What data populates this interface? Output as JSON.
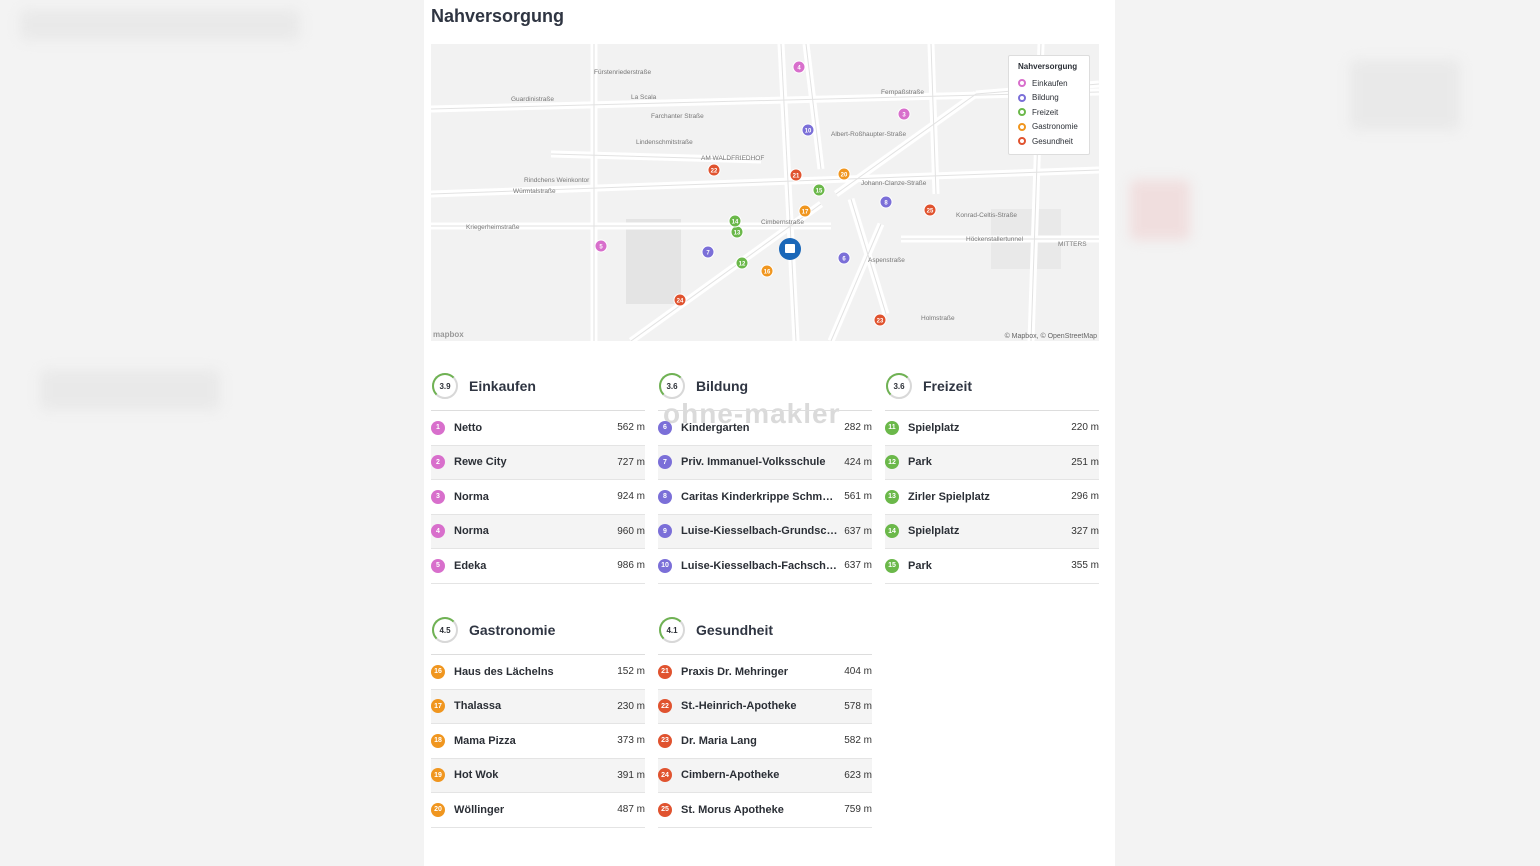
{
  "title": "Nahversorgung",
  "map": {
    "legend": {
      "title": "Nahversorgung",
      "items": [
        {
          "label": "Einkaufen",
          "color": "#d86fcc"
        },
        {
          "label": "Bildung",
          "color": "#7b6fd8"
        },
        {
          "label": "Freizeit",
          "color": "#6bb84a"
        },
        {
          "label": "Gastronomie",
          "color": "#f0961f"
        },
        {
          "label": "Gesundheit",
          "color": "#e0532f"
        }
      ]
    },
    "attribution": "© Mapbox, © OpenStreetMap",
    "logo": "mapbox",
    "labels": [
      "La Scala",
      "Guardinistraße",
      "Farchanter Straße",
      "Rindchens Weinkontor",
      "Würmtalstraße",
      "AM WALDFRIEDHOF",
      "Johann-Clanze-Straße",
      "Albert-Roßhaupter-Straße",
      "Konrad-Celtis-Straße",
      "Höckenstallertunnel",
      "MITTERS",
      "Cimbernstraße",
      "Aspenstraße",
      "Holmstraße",
      "Fernpaßstraße",
      "Lindenschmitstraße",
      "Kriegerheimstraße",
      "Fürstenriederstraße"
    ]
  },
  "watermark": "ohne-makler",
  "sections": [
    {
      "title": "Einkaufen",
      "score": "3.9",
      "color": "#d86fcc",
      "items": [
        {
          "n": "1",
          "name": "Netto",
          "dist": "562 m"
        },
        {
          "n": "2",
          "name": "Rewe City",
          "dist": "727 m"
        },
        {
          "n": "3",
          "name": "Norma",
          "dist": "924 m"
        },
        {
          "n": "4",
          "name": "Norma",
          "dist": "960 m"
        },
        {
          "n": "5",
          "name": "Edeka",
          "dist": "986 m"
        }
      ]
    },
    {
      "title": "Bildung",
      "score": "3.6",
      "color": "#7b6fd8",
      "items": [
        {
          "n": "6",
          "name": "Kindergarten",
          "dist": "282 m"
        },
        {
          "n": "7",
          "name": "Priv. Immanuel-Volksschule",
          "dist": "424 m"
        },
        {
          "n": "8",
          "name": "Caritas Kinderkrippe Schmetterling",
          "dist": "561 m"
        },
        {
          "n": "9",
          "name": "Luise-Kiesselbach-Grundschule",
          "dist": "637 m"
        },
        {
          "n": "10",
          "name": "Luise-Kiesselbach-Fachschule",
          "dist": "637 m"
        }
      ]
    },
    {
      "title": "Freizeit",
      "score": "3.6",
      "color": "#6bb84a",
      "items": [
        {
          "n": "11",
          "name": "Spielplatz",
          "dist": "220 m"
        },
        {
          "n": "12",
          "name": "Park",
          "dist": "251 m"
        },
        {
          "n": "13",
          "name": "Zirler Spielplatz",
          "dist": "296 m"
        },
        {
          "n": "14",
          "name": "Spielplatz",
          "dist": "327 m"
        },
        {
          "n": "15",
          "name": "Park",
          "dist": "355 m"
        }
      ]
    },
    {
      "title": "Gastronomie",
      "score": "4.5",
      "color": "#f0961f",
      "items": [
        {
          "n": "16",
          "name": "Haus des Lächelns",
          "dist": "152 m"
        },
        {
          "n": "17",
          "name": "Thalassa",
          "dist": "230 m"
        },
        {
          "n": "18",
          "name": "Mama Pizza",
          "dist": "373 m"
        },
        {
          "n": "19",
          "name": "Hot Wok",
          "dist": "391 m"
        },
        {
          "n": "20",
          "name": "Wöllinger",
          "dist": "487 m"
        }
      ]
    },
    {
      "title": "Gesundheit",
      "score": "4.1",
      "color": "#e0532f",
      "items": [
        {
          "n": "21",
          "name": "Praxis Dr. Mehringer",
          "dist": "404 m"
        },
        {
          "n": "22",
          "name": "St.-Heinrich-Apotheke",
          "dist": "578 m"
        },
        {
          "n": "23",
          "name": "Dr. Maria Lang",
          "dist": "582 m"
        },
        {
          "n": "24",
          "name": "Cimbern-Apotheke",
          "dist": "623 m"
        },
        {
          "n": "25",
          "name": "St. Morus Apotheke",
          "dist": "759 m"
        }
      ]
    }
  ]
}
